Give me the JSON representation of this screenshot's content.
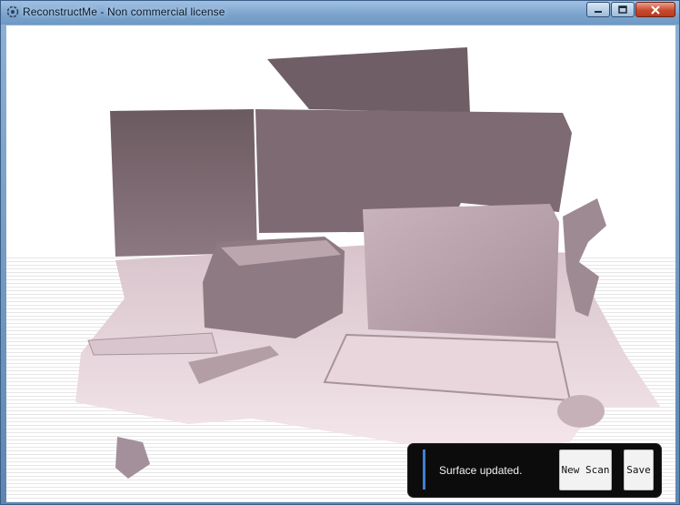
{
  "window": {
    "title": "ReconstructMe - Non commercial license"
  },
  "titlebar": {
    "icons": [
      "app-logo-icon",
      "minimize-icon",
      "maximize-icon",
      "close-icon"
    ]
  },
  "viewport": {
    "description_icon": "3d-scene",
    "surface_color": "#e8d6dc"
  },
  "status": {
    "message": "Surface updated.",
    "new_scan_label": "New Scan",
    "save_label": "Save"
  }
}
